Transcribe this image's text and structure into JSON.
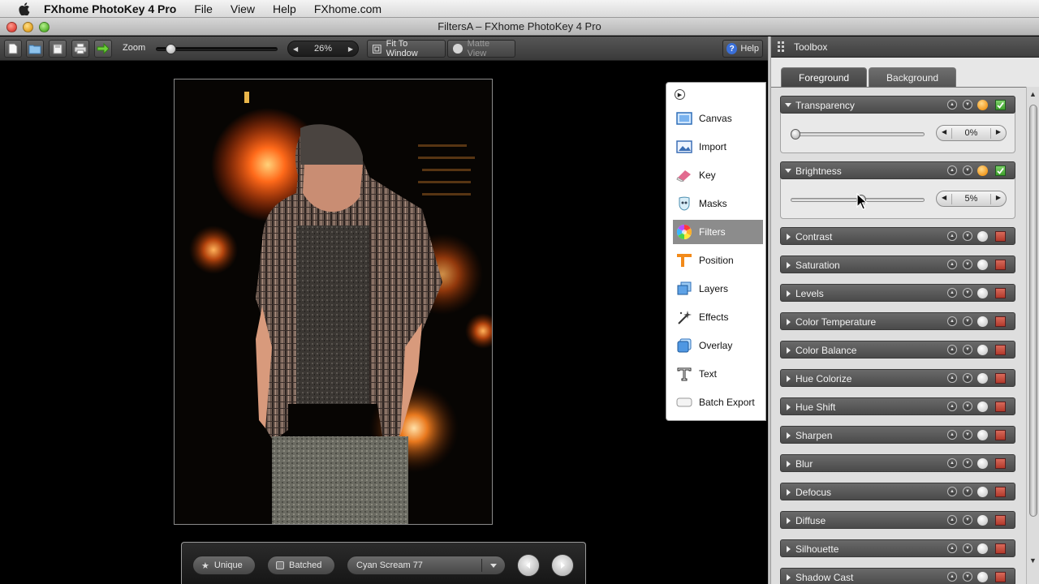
{
  "menubar": {
    "app_name": "FXhome PhotoKey 4 Pro",
    "items": [
      "File",
      "View",
      "Help",
      "FXhome.com"
    ]
  },
  "window": {
    "title": "FiltersA – FXhome PhotoKey 4 Pro"
  },
  "toolbar": {
    "zoom_label": "Zoom",
    "zoom_value": "26%",
    "zoom_slider_level": 0.08,
    "fit_to_window": "Fit To Window",
    "matte_view": "Matte View",
    "help": "Help",
    "file_buttons": [
      "new-document-icon",
      "open-folder-icon",
      "save-icon",
      "print-icon",
      "export-arrow-icon"
    ]
  },
  "sidepanel": {
    "items": [
      {
        "label": "Canvas",
        "icon": "canvas-icon"
      },
      {
        "label": "Import",
        "icon": "import-icon"
      },
      {
        "label": "Key",
        "icon": "key-eraser-icon"
      },
      {
        "label": "Masks",
        "icon": "mask-icon"
      },
      {
        "label": "Filters",
        "icon": "filters-color-wheel-icon",
        "active": true
      },
      {
        "label": "Position",
        "icon": "position-icon"
      },
      {
        "label": "Layers",
        "icon": "layers-icon"
      },
      {
        "label": "Effects",
        "icon": "effects-sparkle-icon"
      },
      {
        "label": "Overlay",
        "icon": "overlay-icon"
      },
      {
        "label": "Text",
        "icon": "text-icon"
      },
      {
        "label": "Batch Export",
        "icon": "batch-export-icon"
      }
    ]
  },
  "bottombar": {
    "unique": "Unique",
    "batched": "Batched",
    "preset": "Cyan Scream 77"
  },
  "toolbox": {
    "title": "Toolbox",
    "tabs": [
      "Foreground",
      "Background"
    ],
    "active_tab": "Foreground",
    "expanded": [
      {
        "label": "Transparency",
        "value": "0%",
        "level": 0.0,
        "enabled": true
      },
      {
        "label": "Brightness",
        "value": "5%",
        "level": 0.53,
        "enabled": true
      }
    ],
    "collapsed": [
      "Contrast",
      "Saturation",
      "Levels",
      "Color Temperature",
      "Color Balance",
      "Hue Colorize",
      "Hue Shift",
      "Sharpen",
      "Blur",
      "Defocus",
      "Diffuse",
      "Silhouette",
      "Shadow Cast"
    ]
  },
  "colors": {
    "accent_active_item": "#8c8c8c",
    "enabled_green": "#3e9e2c",
    "disabled_red": "#b23a2c",
    "orange_toggle": "#f0961a"
  }
}
